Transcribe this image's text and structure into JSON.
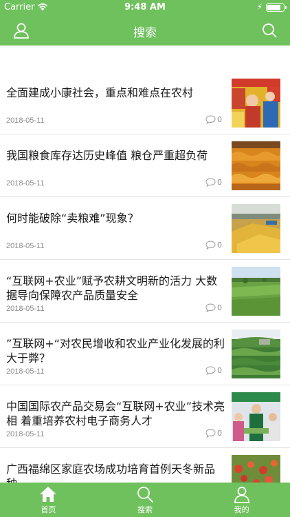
{
  "status_bar": {
    "carrier": "Carrier",
    "time": "9:48 AM",
    "battery_level": 0.9
  },
  "nav": {
    "title": "搜索",
    "left_icon": "user-icon",
    "right_icon": "search-icon"
  },
  "articles": [
    {
      "headline": "全面建成小康社会，重点和难点在农村",
      "date": "2018-05-11",
      "comments": "0",
      "thumb": "people-and-corn"
    },
    {
      "headline": "我国粮食库存达历史峰值 粮仓严重超负荷",
      "date": "2018-05-11",
      "comments": "0",
      "thumb": "corn-pile"
    },
    {
      "headline": "何时能破除“卖粮难”现象？",
      "date": "2018-05-11",
      "comments": "0",
      "thumb": "grain-drying-yard"
    },
    {
      "headline": "“互联网+农业”赋予农耕文明新的活力 大数据导向保障农产品质量安全",
      "date": "2018-05-11",
      "comments": "0",
      "thumb": "green-field"
    },
    {
      "headline": "”互联网+“对农民增收和农业产业化发展的利大于弊？",
      "date": "2018-05-11",
      "comments": "0",
      "thumb": "tea-plantation"
    },
    {
      "headline": "中国国际农产品交易会“互联网+农业”技术亮相 着重培养农村电子商务人才",
      "date": "2018-05-11",
      "comments": "0",
      "thumb": "exhibition-crowd"
    },
    {
      "headline": "广西福绵区家庭农场成功培育首例天冬新品种",
      "date": "",
      "comments": "",
      "thumb": "red-fruit"
    }
  ],
  "tabs": [
    {
      "label": "首页",
      "icon": "home-icon",
      "active": true
    },
    {
      "label": "搜索",
      "icon": "search-icon",
      "active": false
    },
    {
      "label": "我的",
      "icon": "user-icon",
      "active": false
    }
  ],
  "colors": {
    "theme_green": "#6fc15d",
    "divider": "#e2e2e2",
    "meta_text": "#8c8c8c"
  }
}
